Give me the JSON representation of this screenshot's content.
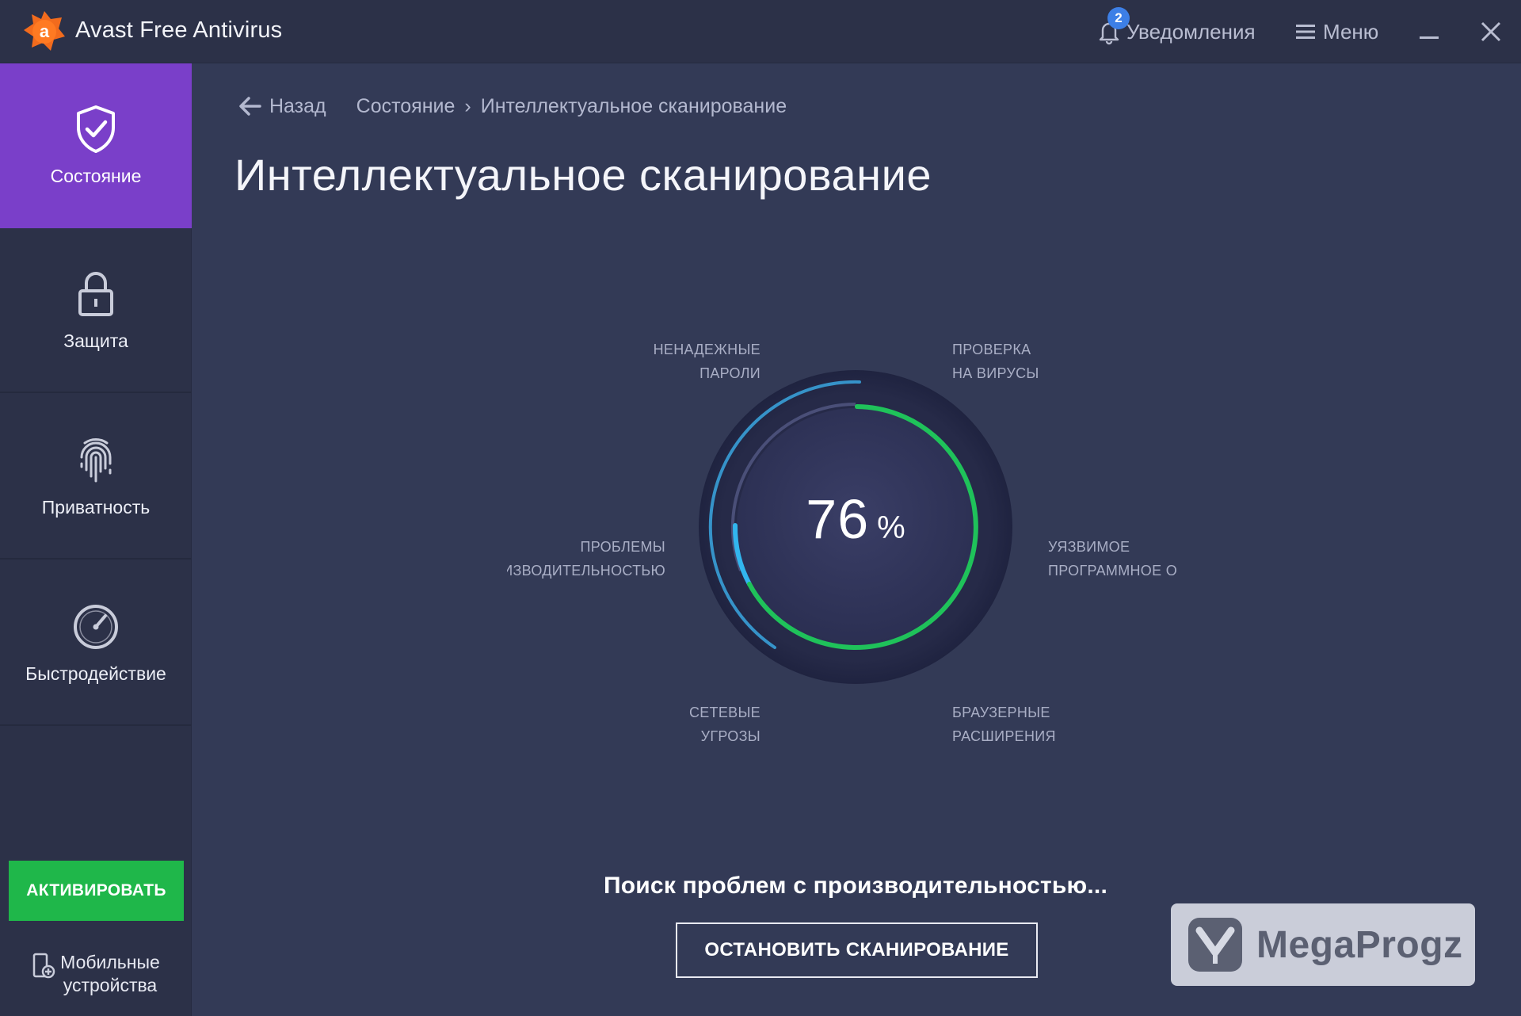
{
  "window": {
    "title": "Avast Free Antivirus",
    "notifications_label": "Уведомления",
    "notifications_count": "2",
    "menu_label": "Меню"
  },
  "sidebar": {
    "items": [
      {
        "label": "Состояние",
        "icon": "shield-check-icon",
        "active": true
      },
      {
        "label": "Защита",
        "icon": "lock-icon",
        "active": false
      },
      {
        "label": "Приватность",
        "icon": "fingerprint-icon",
        "active": false
      },
      {
        "label": "Быстродействие",
        "icon": "speedometer-icon",
        "active": false
      }
    ],
    "activate_label": "АКТИВИРОВАТЬ",
    "mobile_label_line1": "Мобильные",
    "mobile_label_line2": "устройства"
  },
  "breadcrumb": {
    "back_label": "Назад",
    "parent": "Состояние",
    "separator": "›",
    "current": "Интеллектуальное сканирование"
  },
  "page_title": "Интеллектуальное сканирование",
  "scan": {
    "progress_value": "76",
    "progress_unit": "%",
    "categories": [
      {
        "line1": "НЕНАДЕЖНЫЕ",
        "line2": "ПАРОЛИ"
      },
      {
        "line1": "ПРОВЕРКА",
        "line2": "НА ВИРУСЫ"
      },
      {
        "line1": "ПРОБЛЕМЫ",
        "line2": "ПРОИЗВОДИТЕЛЬНОСТЬЮ"
      },
      {
        "line1": "УЯЗВИМОЕ",
        "line2": "ПРОГРАММНОЕ О"
      },
      {
        "line1": "СЕТЕВЫЕ",
        "line2": "УГРОЗЫ"
      },
      {
        "line1": "БРАУЗЕРНЫЕ",
        "line2": "РАСШИРЕНИЯ"
      }
    ],
    "status_text": "Поиск проблем с производительностью...",
    "stop_label": "ОСТАНОВИТЬ СКАНИРОВАНИЕ"
  },
  "watermark": {
    "text": "MegaProgz"
  },
  "colors": {
    "accent_purple": "#7a3fc9",
    "activate_green": "#1fb74a",
    "progress_green": "#1fc25a",
    "progress_blue": "#3aa7e0",
    "background": "#333a56"
  }
}
